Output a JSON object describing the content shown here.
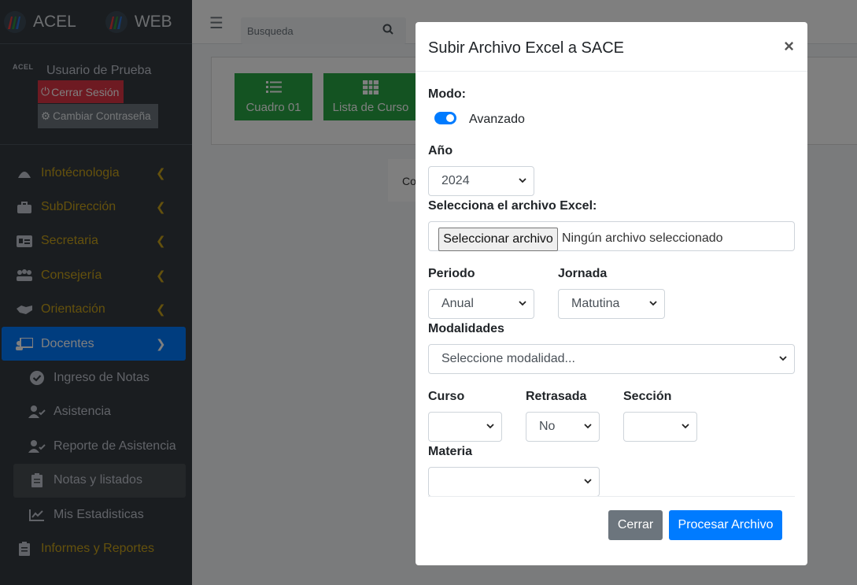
{
  "brand": {
    "left": "ACEL",
    "right": "WEB"
  },
  "user": {
    "mark": "ACEL",
    "name": "Usuario de Prueba",
    "logout_label": "Cerrar Sesión",
    "change_password_label": "Cambiar Contraseña"
  },
  "sidebar": {
    "items": [
      {
        "label": "Infotécnologia",
        "icon": "android-icon"
      },
      {
        "label": "SubDirección",
        "icon": "briefcase-icon"
      },
      {
        "label": "Secretaria",
        "icon": "id-card-icon"
      },
      {
        "label": "Consejería",
        "icon": "meeting-icon"
      },
      {
        "label": "Orientación",
        "icon": "handshake-icon"
      },
      {
        "label": "Docentes",
        "icon": "teacher-icon"
      }
    ],
    "sub_items": [
      {
        "label": "Ingreso de Notas",
        "icon": "check-circle-icon"
      },
      {
        "label": "Asistencia",
        "icon": "user-check-icon"
      },
      {
        "label": "Reporte de Asistencia",
        "icon": "user-check-icon"
      },
      {
        "label": "Notas y listados",
        "icon": "clipboard-icon"
      },
      {
        "label": "Mis Estadisticas",
        "icon": "chart-line-icon"
      }
    ],
    "last": {
      "label": "Informes y Reportes",
      "icon": "clipboard-icon"
    }
  },
  "topbar": {
    "search_placeholder": "Busqueda"
  },
  "content": {
    "tile1_label": "Cuadro 01",
    "tile2_label": "Lista de Curso",
    "card_text": "Co"
  },
  "modal": {
    "title": "Subir Archivo Excel a SACE",
    "close_glyph": "×",
    "mode_label": "Modo:",
    "mode_value": "Avanzado",
    "mode_on": true,
    "year_label": "Año",
    "year_value": "2024",
    "file_label": "Selecciona el archivo Excel:",
    "file_button": "Seleccionar archivo",
    "file_none": "Ningún archivo seleccionado",
    "period_label": "Periodo",
    "period_value": "Anual",
    "shift_label": "Jornada",
    "shift_value": "Matutina",
    "modalities_label": "Modalidades",
    "modalities_value": "Seleccione modalidad...",
    "course_label": "Curso",
    "course_value": "",
    "delayed_label": "Retrasada",
    "delayed_value": "No",
    "section_label": "Sección",
    "section_value": "",
    "subject_label": "Materia",
    "subject_value": "",
    "cancel_label": "Cerrar",
    "submit_label": "Procesar Archivo"
  },
  "colors": {
    "primary": "#007bff",
    "danger": "#dc3545",
    "secondary": "#6c757d",
    "success": "#28a745",
    "sidebar_bg": "#343a40",
    "sidebar_text_accent": "#c9a21a"
  }
}
